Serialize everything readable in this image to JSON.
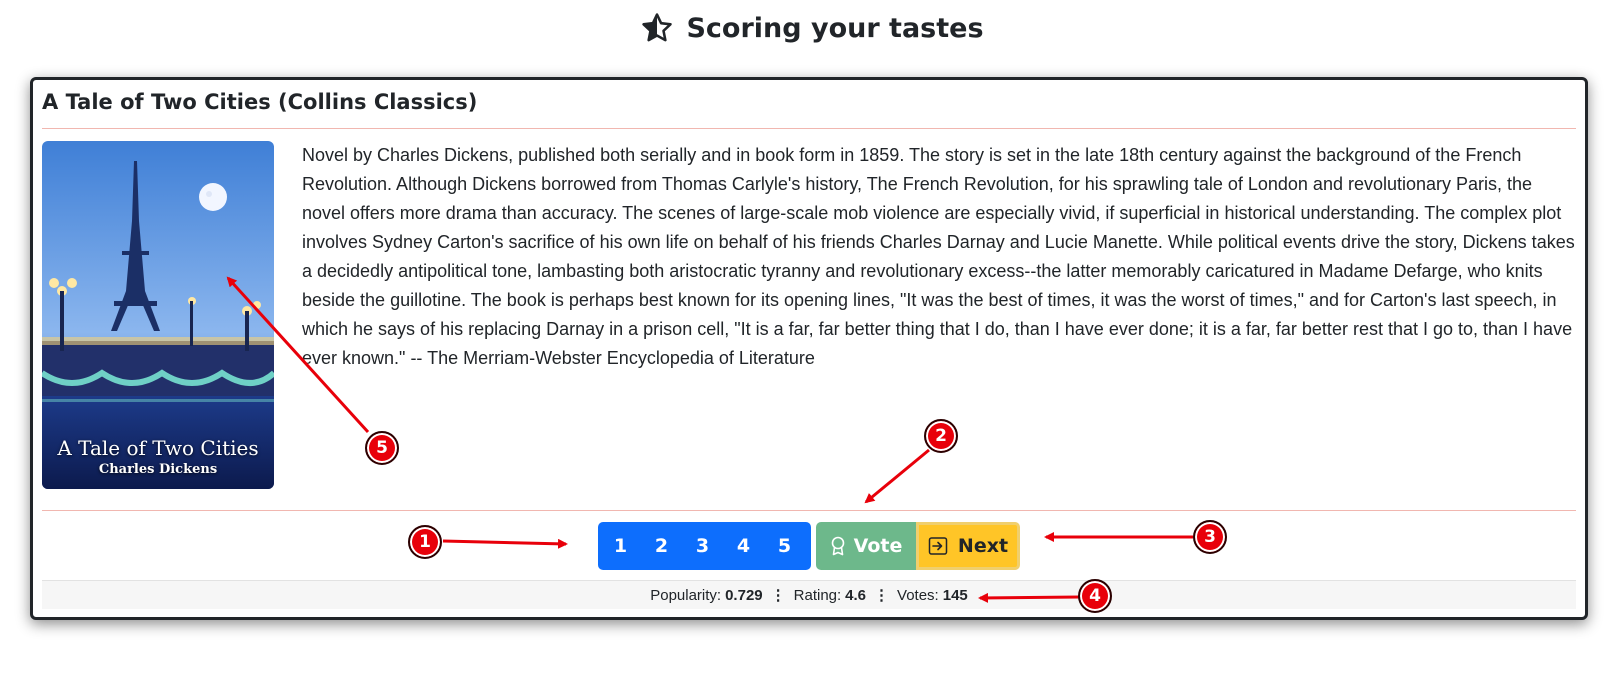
{
  "header": {
    "title": "Scoring your tastes",
    "icon": "star-half-icon"
  },
  "book": {
    "title": "A Tale of Two Cities (Collins Classics)",
    "cover": {
      "title": "A Tale of Two Cities",
      "author": "Charles Dickens",
      "icon": "book-cover-image"
    },
    "description": "Novel by Charles Dickens, published both serially and in book form in 1859. The story is set in the late 18th century against the background of the French Revolution. Although Dickens borrowed from Thomas Carlyle's history, The French Revolution, for his sprawling tale of London and revolutionary Paris, the novel offers more drama than accuracy. The scenes of large-scale mob violence are especially vivid, if superficial in historical understanding. The complex plot involves Sydney Carton's sacrifice of his own life on behalf of his friends Charles Darnay and Lucie Manette. While political events drive the story, Dickens takes a decidedly antipolitical tone, lambasting both aristocratic tyranny and revolutionary excess--the latter memorably caricatured in Madame Defarge, who knits beside the guillotine. The book is perhaps best known for its opening lines, \"It was the best of times, it was the worst of times,\" and for Carton's last speech, in which he says of his replacing Darnay in a prison cell, \"It is a far, far better thing that I do, than I have ever done; it is a far, far better rest that I go to, than I have ever known.\" -- The Merriam-Webster Encyclopedia of Literature"
  },
  "actions": {
    "ratings": [
      "1",
      "2",
      "3",
      "4",
      "5"
    ],
    "vote_label": "Vote",
    "vote_icon": "award-icon",
    "next_label": "Next",
    "next_icon": "box-arrow-right-icon"
  },
  "stats": {
    "popularity_label": "Popularity:",
    "popularity_value": "0.729",
    "rating_label": "Rating:",
    "rating_value": "4.6",
    "votes_label": "Votes:",
    "votes_value": "145",
    "separator": "⋮"
  },
  "annotations": [
    "1",
    "2",
    "3",
    "4",
    "5"
  ],
  "colors": {
    "rating_group": "#0d6efd",
    "vote_button": "#6db88b",
    "next_button": "#ffc527",
    "annotation": "#e8000a"
  }
}
